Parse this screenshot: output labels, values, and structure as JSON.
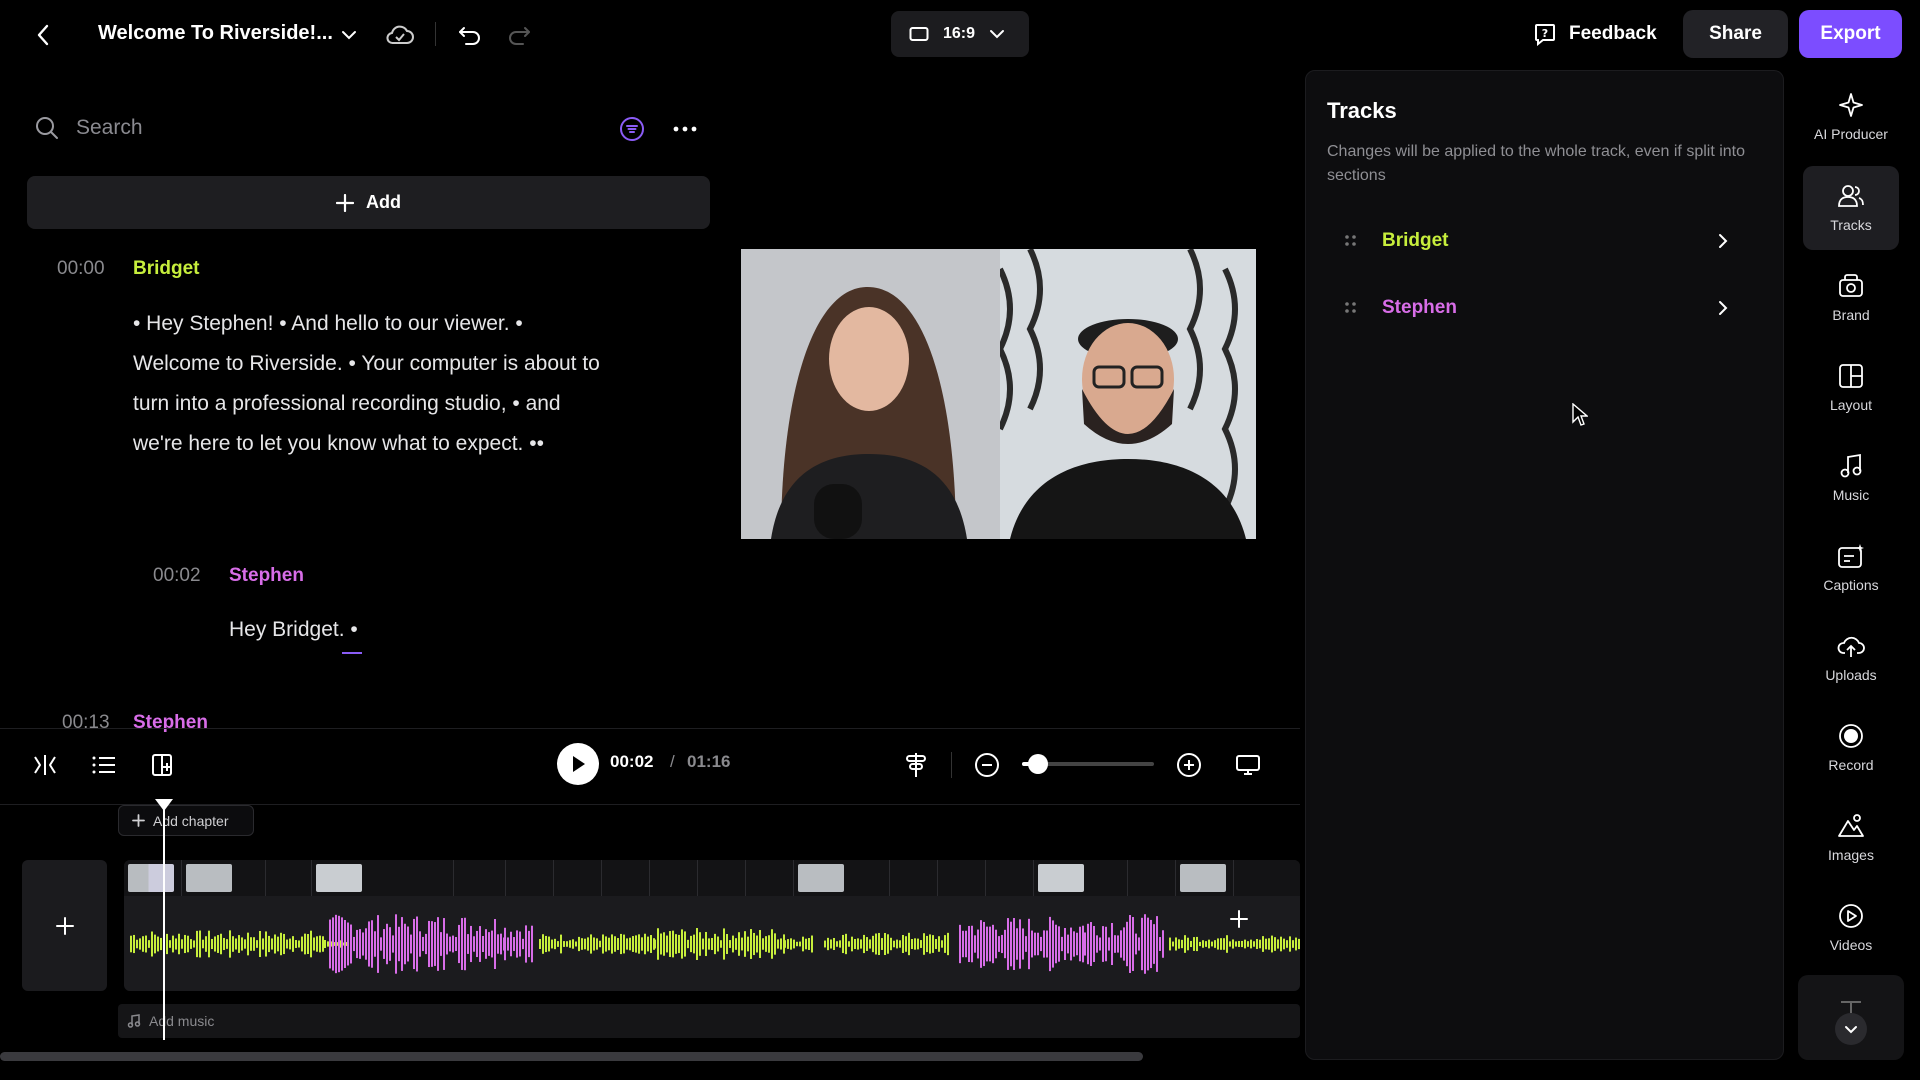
{
  "header": {
    "project_title": "Welcome To Riverside!...",
    "aspect_ratio": "16:9",
    "feedback_label": "Feedback",
    "share_label": "Share",
    "export_label": "Export"
  },
  "transcript": {
    "search_placeholder": "Search",
    "add_label": "Add",
    "entries": [
      {
        "time": "00:00",
        "speaker": "Bridget",
        "text": "• Hey Stephen! • And hello to our viewer. • Welcome to Riverside. • Your computer is about to turn into a professional recording studio, • and we're here to let you know what to expect. ••"
      },
      {
        "time": "00:02",
        "speaker": "Stephen",
        "text": "Hey Bridget. •"
      },
      {
        "time": "00:13",
        "speaker": "Stephen",
        "text": ""
      }
    ]
  },
  "playback": {
    "current_time": "00:02",
    "separator": "/",
    "duration": "01:16",
    "zoom_level": 0.12
  },
  "timeline": {
    "add_chapter_label": "Add chapter",
    "add_music_label": "Add music"
  },
  "tracks_panel": {
    "title": "Tracks",
    "description": "Changes will be applied to the whole track, even if split into sections",
    "tracks": [
      {
        "name": "Bridget",
        "color": "#c7ee3c"
      },
      {
        "name": "Stephen",
        "color": "#d86de8"
      }
    ]
  },
  "rail": {
    "items": [
      {
        "label": "AI Producer",
        "icon": "sparkle-icon"
      },
      {
        "label": "Tracks",
        "icon": "people-icon"
      },
      {
        "label": "Brand",
        "icon": "brand-icon"
      },
      {
        "label": "Layout",
        "icon": "layout-icon"
      },
      {
        "label": "Music",
        "icon": "music-note-icon"
      },
      {
        "label": "Captions",
        "icon": "captions-icon"
      },
      {
        "label": "Uploads",
        "icon": "upload-icon"
      },
      {
        "label": "Record",
        "icon": "record-icon"
      },
      {
        "label": "Images",
        "icon": "images-icon"
      },
      {
        "label": "Videos",
        "icon": "video-play-icon"
      }
    ]
  },
  "colors": {
    "accent": "#7c4dff",
    "bridget": "#c7ee3c",
    "stephen": "#d86de8"
  }
}
